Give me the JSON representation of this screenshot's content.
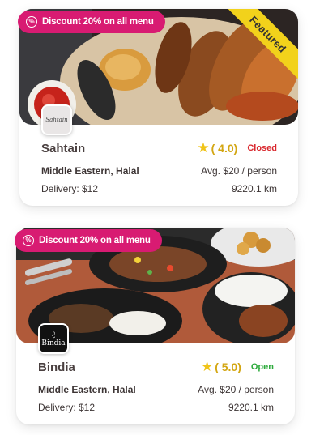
{
  "restaurants": [
    {
      "discount": "Discount 20% on all menu",
      "featured": "Featured",
      "logo_text": "Sahtain",
      "name": "Sahtain",
      "rating": "( 4.0)",
      "status": "Closed",
      "cuisine": "Middle Eastern, Halal",
      "avg_price": "Avg. $20 / person",
      "delivery": "Delivery: $12",
      "distance": "9220.1 km"
    },
    {
      "discount": "Discount 20% on all menu",
      "logo_text": "Bindia",
      "name": "Bindia",
      "rating": "( 5.0)",
      "status": "Open",
      "cuisine": "Middle Eastern, Halal",
      "avg_price": "Avg. $20 / person",
      "delivery": "Delivery: $12",
      "distance": "9220.1 km"
    }
  ],
  "colors": {
    "discount_badge": "#d81b72",
    "featured_ribbon": "#f2d21b",
    "star": "#f0c419",
    "closed": "#d9282e",
    "open": "#2eab3d"
  },
  "icons": {
    "discount": "percent-badge-icon",
    "rating": "star-icon"
  }
}
